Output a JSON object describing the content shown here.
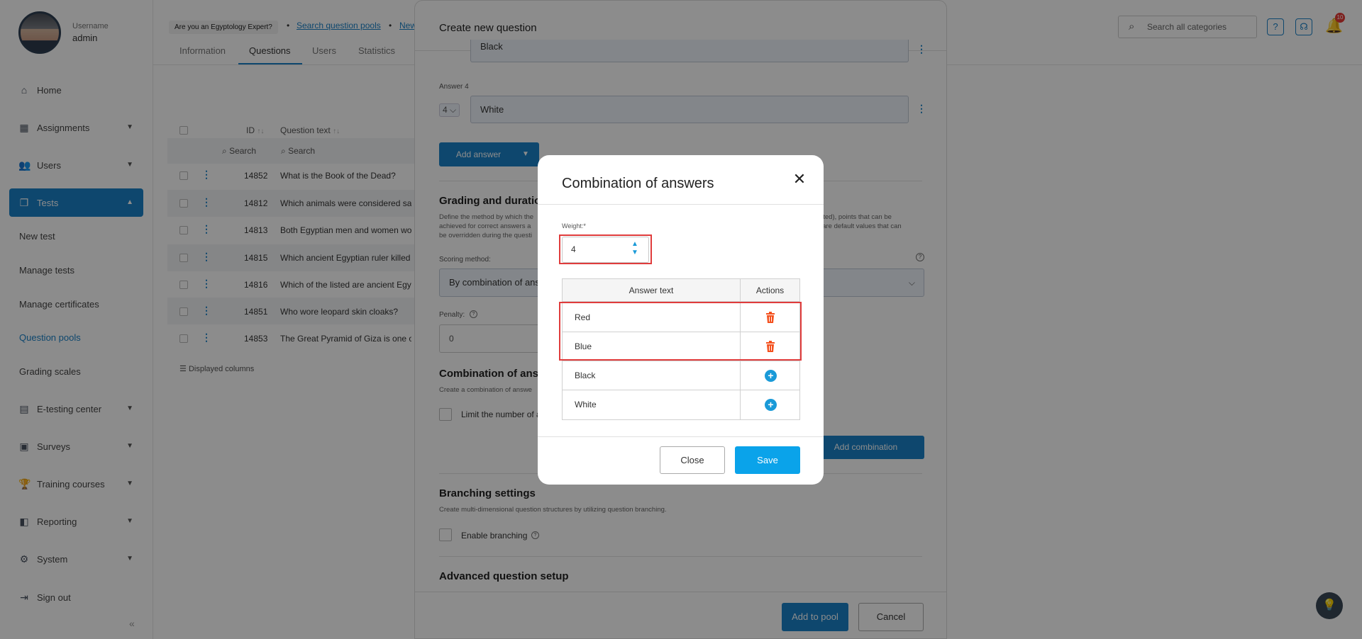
{
  "user": {
    "username_label": "Username",
    "username": "admin"
  },
  "sidebar": {
    "items": [
      {
        "label": "Home",
        "icon": "home-icon"
      },
      {
        "label": "Assignments",
        "icon": "dashboard-icon"
      },
      {
        "label": "Users",
        "icon": "users-icon"
      },
      {
        "label": "Tests",
        "icon": "tests-icon"
      },
      {
        "label": "E-testing center",
        "icon": "calendar-icon"
      },
      {
        "label": "Surveys",
        "icon": "survey-icon"
      },
      {
        "label": "Training courses",
        "icon": "trophy-icon"
      },
      {
        "label": "Reporting",
        "icon": "chart-icon"
      },
      {
        "label": "System",
        "icon": "gear-icon"
      },
      {
        "label": "Sign out",
        "icon": "signout-icon"
      }
    ],
    "tests_sub": [
      "New test",
      "Manage tests",
      "Manage certificates",
      "Question pools",
      "Grading scales"
    ]
  },
  "header": {
    "expert_badge": "Are you an Egyptology Expert?",
    "crumb_search_pools": "Search question pools",
    "crumb_new": "New",
    "tabs": [
      "Information",
      "Questions",
      "Users",
      "Statistics"
    ],
    "search_placeholder": "Search all categories",
    "notifications_count": "10"
  },
  "table": {
    "col_id": "ID",
    "col_question": "Question text",
    "search_label": "Search",
    "rows": [
      {
        "id": "14852",
        "text": "What is the Book of the Dead?"
      },
      {
        "id": "14812",
        "text": "Which animals were considered sacred"
      },
      {
        "id": "14813",
        "text": "Both Egyptian men and women wore"
      },
      {
        "id": "14815",
        "text": "Which ancient Egyptian ruler killed t"
      },
      {
        "id": "14816",
        "text": "Which of the listed are ancient Egyp"
      },
      {
        "id": "14851",
        "text": "Who wore leopard skin cloaks?"
      },
      {
        "id": "14853",
        "text": "The Great Pyramid of Giza is one of"
      }
    ],
    "displayed_columns": "Displayed columns"
  },
  "panel": {
    "title": "Create new question",
    "answer3_value": "Black",
    "answer4_label": "Answer 4",
    "answer4_num": "4",
    "answer4_value": "White",
    "add_answer": "Add answer",
    "grading_title": "Grading and duration",
    "grading_desc_left": "Define the method by which the\nachieved for correct answers a\nbe overridden during the questi",
    "grading_desc_right": "limited), points that can be\non are default values that can",
    "scoring_label": "Scoring method:",
    "scoring_value": "By combination of answ",
    "penalty_label": "Penalty:",
    "penalty_value": "0",
    "combo_title": "Combination of answ",
    "combo_desc": "Create a combination of answe",
    "limit_label": "Limit the number of a",
    "add_combination": "Add combination",
    "branching_title": "Branching settings",
    "branching_desc": "Create multi-dimensional question structures by utilizing question branching.",
    "enable_branching": "Enable branching",
    "advanced_title": "Advanced question setup",
    "add_to_pool": "Add to pool",
    "cancel": "Cancel"
  },
  "modal": {
    "title": "Combination of answers",
    "weight_label": "Weight:*",
    "weight_value": "4",
    "col_answer": "Answer text",
    "col_actions": "Actions",
    "answers": [
      {
        "text": "Red",
        "action": "delete"
      },
      {
        "text": "Blue",
        "action": "delete"
      },
      {
        "text": "Black",
        "action": "add"
      },
      {
        "text": "White",
        "action": "add"
      }
    ],
    "close_label": "Close",
    "save_label": "Save"
  },
  "colors": {
    "accent": "#1a82c8",
    "save": "#0aa3ea",
    "highlight": "#e03c3c",
    "trash": "#f4511e"
  }
}
